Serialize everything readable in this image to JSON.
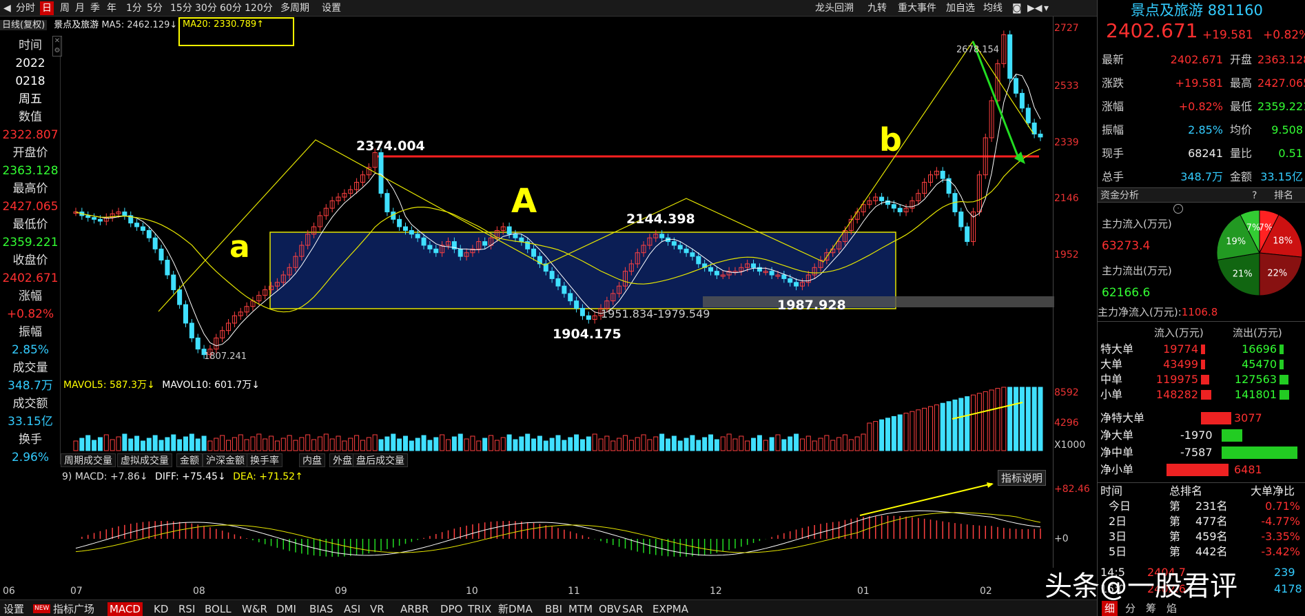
{
  "toolbar": {
    "items": [
      "分时",
      "日",
      "周",
      "月",
      "季",
      "年",
      "1分",
      "5分",
      "15分",
      "30分",
      "60分",
      "120分",
      "多周期",
      "设置"
    ],
    "active_index": 1,
    "right_items": [
      "龙头回溯",
      "九转",
      "重大事件",
      "加自选",
      "均线"
    ]
  },
  "chart_header": {
    "period": "日线(复权)",
    "name": "景点及旅游",
    "ma5": "MA5: 2462.129↓",
    "ma20": "MA20: 2330.789↑"
  },
  "left_panel": {
    "items": [
      {
        "label": "时间",
        "value": "2022"
      },
      {
        "label": "",
        "value": "0218"
      },
      {
        "label": "",
        "value": "周五"
      },
      {
        "label": "数值",
        "value": "2322.807"
      },
      {
        "label": "开盘价",
        "value": "2363.128"
      },
      {
        "label": "最高价",
        "value": "2427.065"
      },
      {
        "label": "最低价",
        "value": "2359.221"
      },
      {
        "label": "收盘价",
        "value": "2402.671"
      },
      {
        "label": "涨幅",
        "value": "+0.82%"
      },
      {
        "label": "振幅",
        "value": "2.85%"
      },
      {
        "label": "成交量",
        "value": "348.7万"
      },
      {
        "label": "成交额",
        "value": "33.15亿"
      },
      {
        "label": "换手",
        "value": "2.96%"
      }
    ]
  },
  "annotations": {
    "a": "a",
    "A": "A",
    "b": "b",
    "high1": "2374.004",
    "mid_high": "2144.398",
    "low1": "1904.175",
    "range": "1951.834-1979.549",
    "low2": "1987.928",
    "peak": "2678.154",
    "trough": "1807.241"
  },
  "price_axis": [
    "2727",
    "2533",
    "2339",
    "2146",
    "1952"
  ],
  "volume_header": {
    "mavol5": "MAVOL5: 587.3万↓",
    "mavol10": "MAVOL10: 601.7万↓"
  },
  "volume_axis": [
    "8592",
    "4296",
    "X1000"
  ],
  "volume_tabs": [
    "周期成交量",
    "虚拟成交量",
    "金额",
    "沪深金额",
    "换手率",
    "内盘",
    "外盘",
    "盘后成交量"
  ],
  "macd_header": {
    "macd": "9) MACD: +7.86↓",
    "diff": "DIFF: +75.45↓",
    "dea": "DEA: +71.52↑",
    "help": "指标说明"
  },
  "macd_axis": [
    "+82.46",
    "+0"
  ],
  "date_axis": [
    "06",
    "07",
    "08",
    "09",
    "10",
    "11",
    "12",
    "01",
    "02"
  ],
  "bottom_bar": [
    "设置",
    "指标广场",
    "MACD",
    "KD",
    "RSI",
    "BOLL",
    "W&R",
    "DMI",
    "BIAS",
    "ASI",
    "VR",
    "ARBR",
    "DPO",
    "TRIX",
    "新DMA",
    "BBI",
    "MTM",
    "OBV",
    "SAR",
    "EXPMA"
  ],
  "bottom_active": "MACD",
  "quote": {
    "title": "景点及旅游",
    "code": "881160",
    "price": "2402.671",
    "change": "+19.581",
    "pct": "+0.82%",
    "rows": [
      [
        "最新",
        "2402.671",
        "开盘",
        "2363.128"
      ],
      [
        "涨跌",
        "+19.581",
        "最高",
        "2427.065"
      ],
      [
        "涨幅",
        "+0.82%",
        "最低",
        "2359.221"
      ],
      [
        "振幅",
        "2.85%",
        "均价",
        "9.508"
      ],
      [
        "现手",
        "68241",
        "量比",
        "0.51"
      ],
      [
        "总手",
        "348.7万",
        "金额",
        "33.15亿"
      ]
    ]
  },
  "fund": {
    "title": "资金分析",
    "buttons": [
      "?",
      "排名"
    ],
    "inflow_label": "主力流入(万元)",
    "inflow": "63273.4",
    "outflow_label": "主力流出(万元)",
    "outflow": "62166.6",
    "net_label": "主力净流入(万元):",
    "net": "1106.8",
    "pie": [
      {
        "label": "7%",
        "value": 7,
        "color": "#ff2222"
      },
      {
        "label": "18%",
        "value": 18,
        "color": "#cc1111"
      },
      {
        "label": "22%",
        "value": 22,
        "color": "#881111"
      },
      {
        "label": "21%",
        "value": 21,
        "color": "#116611"
      },
      {
        "label": "19%",
        "value": 19,
        "color": "#229922"
      },
      {
        "label": "7%",
        "value": 7,
        "color": "#33cc33"
      }
    ],
    "flow_header": [
      "流入(万元)",
      "流出(万元)"
    ],
    "flow_rows": [
      [
        "特大单",
        "19774",
        "16696"
      ],
      [
        "大单",
        "43499",
        "45470"
      ],
      [
        "中单",
        "119975",
        "127563"
      ],
      [
        "小单",
        "148282",
        "141801"
      ]
    ],
    "net_rows": [
      [
        "净特大单",
        "3077"
      ],
      [
        "净大单",
        "-1970"
      ],
      [
        "净中单",
        "-7587"
      ],
      [
        "净小单",
        "6481"
      ]
    ],
    "rank_header": [
      "时间",
      "总排名",
      "大单净比"
    ],
    "rank_rows": [
      [
        "今日",
        "第",
        "231名",
        "0.71%"
      ],
      [
        "2日",
        "第",
        "477名",
        "-4.77%"
      ],
      [
        "3日",
        "第",
        "459名",
        "-3.35%"
      ],
      [
        "5日",
        "第",
        "442名",
        "-3.42%"
      ]
    ],
    "partial_rows": [
      [
        "14:5",
        "2404.7",
        "239"
      ],
      [
        "15:0",
        "2402.6",
        "4178"
      ]
    ],
    "bottom_tabs": [
      "细",
      "分",
      "筹",
      "焰"
    ]
  },
  "watermark": "头条@一股君评"
}
